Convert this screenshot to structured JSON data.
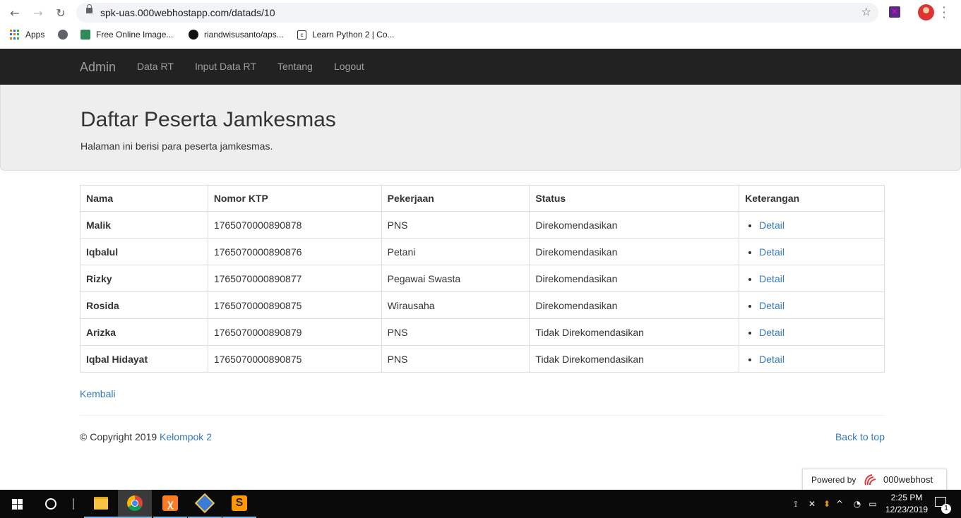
{
  "browser": {
    "url": "spk-uas.000webhostapp.com/datads/10",
    "back_icon": "←",
    "forward_icon": "→",
    "reload_icon": "↻",
    "star_icon": "☆",
    "bookmarks": [
      {
        "label": "Apps"
      },
      {
        "label": ""
      },
      {
        "label": "Free Online Image..."
      },
      {
        "label": "riandwisusanto/aps..."
      },
      {
        "label": "Learn Python 2 | Co..."
      }
    ]
  },
  "navbar": {
    "brand": "Admin",
    "links": [
      "Data RT",
      "Input Data RT",
      "Tentang",
      "Logout"
    ]
  },
  "jumbotron": {
    "title": "Daftar Peserta Jamkesmas",
    "subtitle": "Halaman ini berisi para peserta jamkesmas."
  },
  "table": {
    "headers": [
      "Nama",
      "Nomor KTP",
      "Pekerjaan",
      "Status",
      "Keterangan"
    ],
    "rows": [
      {
        "nama": "Malik",
        "ktp": "1765070000890878",
        "pekerjaan": "PNS",
        "status": "Direkomendasikan",
        "ket": "Detail"
      },
      {
        "nama": "Iqbalul",
        "ktp": "1765070000890876",
        "pekerjaan": "Petani",
        "status": "Direkomendasikan",
        "ket": "Detail"
      },
      {
        "nama": "Rizky",
        "ktp": "1765070000890877",
        "pekerjaan": "Pegawai Swasta",
        "status": "Direkomendasikan",
        "ket": "Detail"
      },
      {
        "nama": "Rosida",
        "ktp": "1765070000890875",
        "pekerjaan": "Wirausaha",
        "status": "Direkomendasikan",
        "ket": "Detail"
      },
      {
        "nama": "Arizka",
        "ktp": "1765070000890879",
        "pekerjaan": "PNS",
        "status": "Tidak Direkomendasikan",
        "ket": "Detail"
      },
      {
        "nama": "Iqbal Hidayat",
        "ktp": "1765070000890875",
        "pekerjaan": "PNS",
        "status": "Tidak Direkomendasikan",
        "ket": "Detail"
      }
    ]
  },
  "back_link": "Kembali",
  "footer": {
    "copyright": "© Copyright 2019 ",
    "team": "Kelompok 2",
    "back_to_top": "Back to top"
  },
  "powered": {
    "label": "Powered by",
    "brand": "000webhost"
  },
  "taskbar": {
    "time": "2:25 PM",
    "date": "12/23/2019",
    "notification_count": "1"
  },
  "colors": {
    "navbar_bg": "#222222",
    "link": "#337ab7",
    "jumbotron_bg": "#eeeeee"
  }
}
